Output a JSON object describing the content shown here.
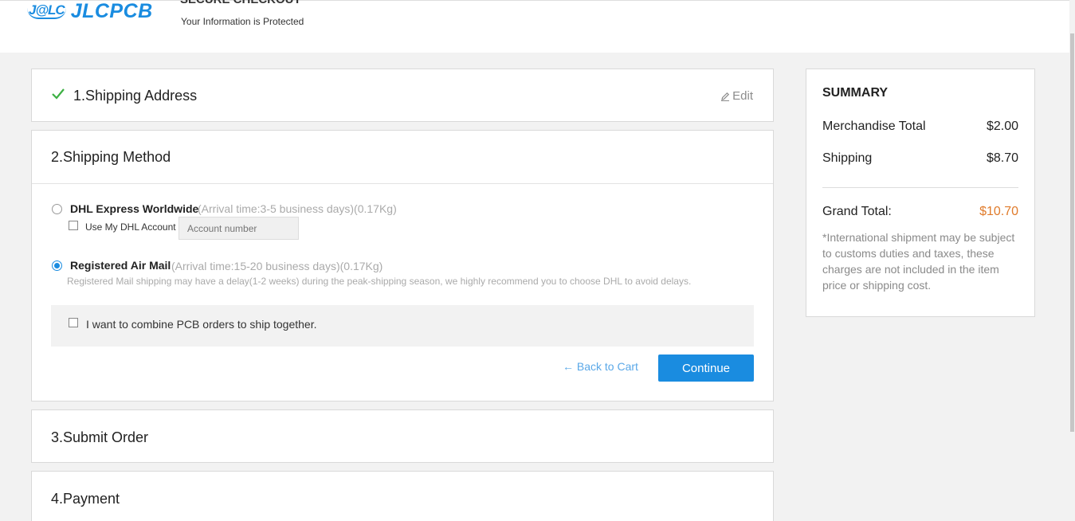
{
  "header": {
    "logo_mark": "J@LC",
    "logo_text": "JLCPCB",
    "secure_title": "SECURE CHECKOUT",
    "secure_subtitle": "Your Information is Protected"
  },
  "steps": {
    "shipping_address": {
      "title": "1.Shipping Address",
      "edit_label": "Edit"
    },
    "shipping_method": {
      "title": "2.Shipping Method",
      "options": [
        {
          "label": "DHL Express Worldwide",
          "info": "(Arrival time:3-5 business days)(0.17Kg)",
          "selected": false
        },
        {
          "label": "Registered Air Mail",
          "info": "(Arrival time:15-20 business days)(0.17Kg)",
          "selected": true
        }
      ],
      "dhl_account_label": "Use My DHL Account",
      "dhl_account_placeholder": "Account number",
      "delay_note": "Registered Mail shipping may have a delay(1-2 weeks) during the peak-shipping season, we highly recommend you to choose DHL to avoid delays.",
      "combine_label": "I want to combine PCB orders to ship together.",
      "back_label": "← Back to Cart",
      "continue_label": "Continue"
    },
    "submit_order": {
      "title": "3.Submit Order"
    },
    "payment": {
      "title": "4.Payment"
    }
  },
  "summary": {
    "title": "SUMMARY",
    "merchandise_label": "Merchandise Total",
    "merchandise_value": "$2.00",
    "shipping_label": "Shipping",
    "shipping_value": "$8.70",
    "grand_label": "Grand Total:",
    "grand_value": "$10.70",
    "note": "*International shipment may be subject to customs duties and taxes, these charges are not included in the item price or shipping cost."
  },
  "colors": {
    "accent": "#1a8ce0",
    "grand_total": "#e07b2b",
    "check": "#3cb043"
  },
  "icons": {
    "check": "check-icon",
    "edit": "pencil-icon",
    "back": "arrow-left-icon"
  }
}
